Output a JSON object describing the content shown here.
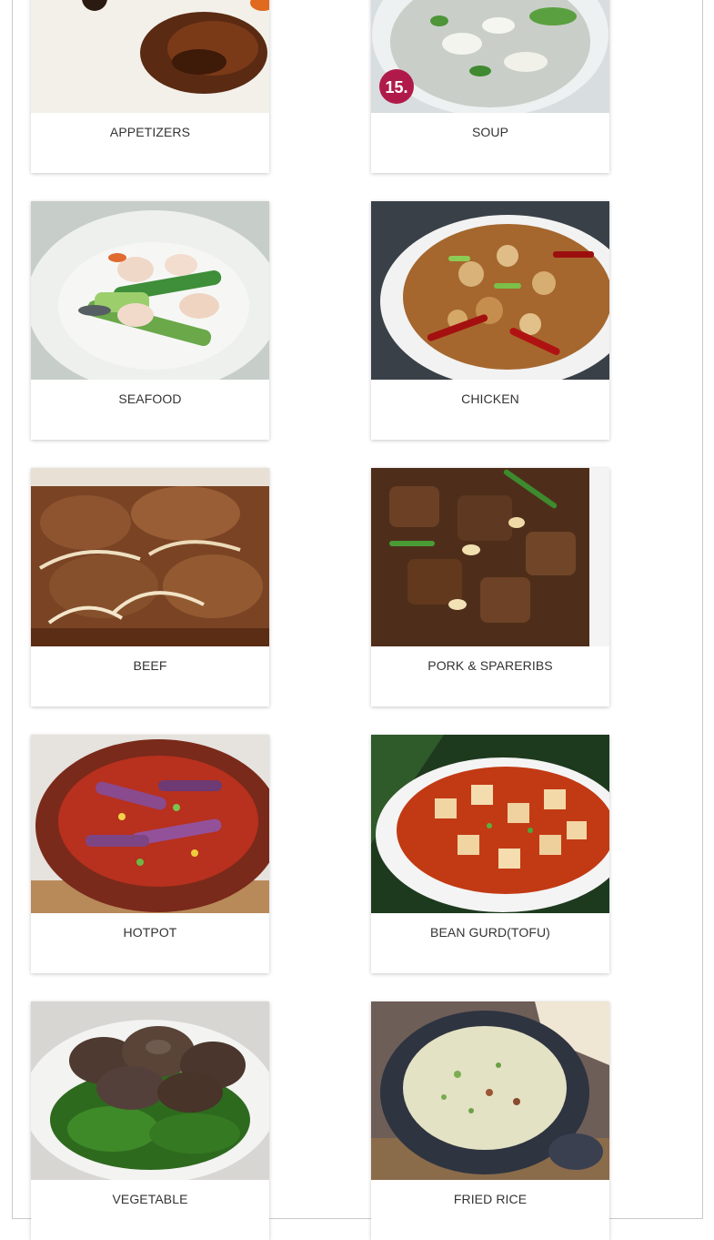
{
  "menu": {
    "categories": [
      {
        "label": "APPETIZERS",
        "image": "roast-duck-photo"
      },
      {
        "label": "SOUP",
        "image": "tofu-soup-photo",
        "badge": "15."
      },
      {
        "label": "SEAFOOD",
        "image": "shrimp-celery-photo"
      },
      {
        "label": "CHICKEN",
        "image": "kung-pao-chicken-photo"
      },
      {
        "label": "BEEF",
        "image": "beef-onion-photo"
      },
      {
        "label": "PORK & SPARERIBS",
        "image": "spareribs-photo"
      },
      {
        "label": "HOTPOT",
        "image": "eggplant-hotpot-photo"
      },
      {
        "label": "BEAN GURD(TOFU)",
        "image": "mapo-tofu-photo"
      },
      {
        "label": "VEGETABLE",
        "image": "mushroom-greens-photo"
      },
      {
        "label": "FRIED RICE",
        "image": "clay-pot-rice-photo"
      }
    ]
  },
  "colors": {
    "card_label": "#333333",
    "badge": "#b01a4a",
    "frame_border": "#c9c9c9"
  }
}
